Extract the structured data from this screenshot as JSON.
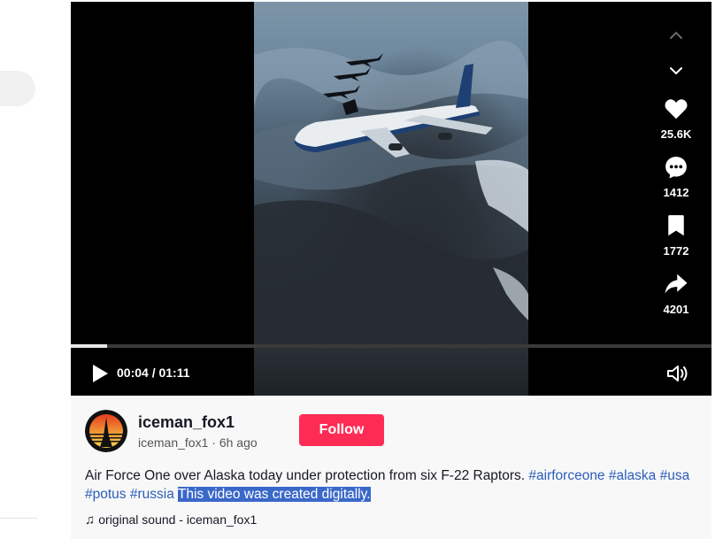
{
  "video": {
    "time": "00:04 / 01:11",
    "progress": 0.056
  },
  "actions": {
    "like": "25.6K",
    "comment": "1412",
    "save": "1772",
    "share": "4201"
  },
  "author": {
    "display_name": "iceman_fox1",
    "handle": "iceman_fox1",
    "separator": "·",
    "posted": "6h ago"
  },
  "follow_label": "Follow",
  "caption": {
    "text": "Air Force One over Alaska today under protection from six F-22 Raptors. ",
    "tags": [
      "#airforceone",
      "#alaska",
      "#usa",
      "#potus",
      "#russia"
    ],
    "note": "This video was created digitally."
  },
  "sound": {
    "icon": "music-note-icon",
    "label": "original sound - iceman_fox1"
  },
  "colors": {
    "follow": "#fe2c55",
    "hashtag": "#2b5db9",
    "selection": "#3a68c9"
  }
}
